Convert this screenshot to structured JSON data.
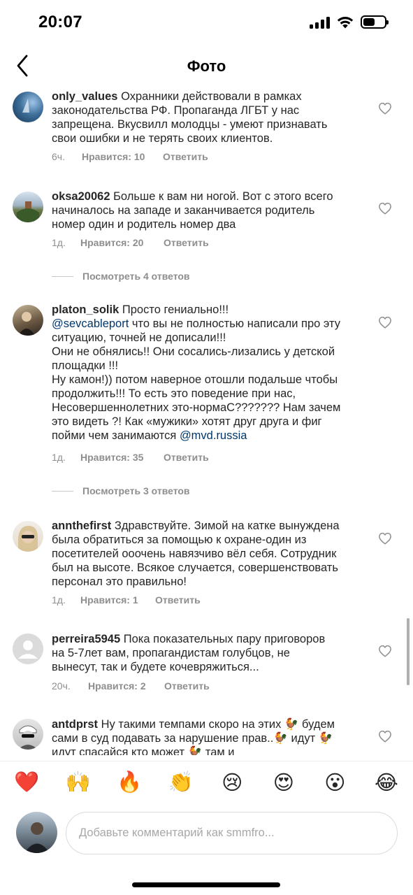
{
  "status_bar": {
    "time": "20:07",
    "battery_level": 0.55,
    "icons": [
      "signal-icon",
      "wifi-icon",
      "battery-icon"
    ]
  },
  "header": {
    "title": "Фото",
    "back_icon": "chevron-left-icon"
  },
  "comments": [
    {
      "username": "only_values",
      "lines": [
        "Охранники действовали в рамках",
        "законодательства РФ. Пропаганда ЛГБТ у нас",
        "запрещена. Вкусвилл молодцы - умеют признавать",
        "свои ошибки и не терять своих клиентов."
      ],
      "time": "6ч.",
      "likes": "Нравится: 10",
      "reply": "Ответить"
    },
    {
      "username": "oksa20062",
      "lines": [
        "Больше к вам ни ногой. Вот с этого всего",
        "начиналось на западе и заканчивается родитель",
        "номер один и родитель номер два"
      ],
      "time": "1д.",
      "likes": "Нравится: 20",
      "reply": "Ответить",
      "view_replies": "Посмотреть 4 ответов"
    },
    {
      "username": "platon_solik",
      "line1": "Просто гениально!!!",
      "mention1": "@sevcableport",
      "line2": "что вы не полностью написали про эту",
      "lines": [
        "ситуацию, точней не дописали!!!",
        "Они не обнялись!! Они сосались-лизались у детской",
        "площадки !!!",
        "Ну камон!)) потом наверное отошли  подальше чтобы",
        "продолжить!!! То есть это поведение при нас,",
        "Несовершеннолетних это-нормаС??????? Нам зачем",
        "это видеть ?! Как «мужики» хотят друг друга и фиг"
      ],
      "last_line": "пойми чем занимаются",
      "mention2": "@mvd.russia",
      "time": "1д.",
      "likes": "Нравится: 35",
      "reply": "Ответить",
      "view_replies": "Посмотреть 3 ответов"
    },
    {
      "username": "annthefirst",
      "lines": [
        "Здравствуйте. Зимой на катке вынуждена",
        "была обратиться за помощью к охране-один из",
        "посетителей ооочень навязчиво вёл себя. Сотрудник",
        "был на высоте. Всякое случается, совершенствовать",
        "персонал это правильно!"
      ],
      "time": "1д.",
      "likes": "Нравится: 1",
      "reply": "Ответить"
    },
    {
      "username": "perreira5945",
      "lines": [
        "Пока показательных пару приговоров",
        "на 5-7лет вам, пропагандистам голубцов, не",
        "вынесут, так и будете кочевряжиться..."
      ],
      "time": "20ч.",
      "likes": "Нравится: 2",
      "reply": "Ответить"
    },
    {
      "username": "antdprst",
      "lines": [
        "Ну такими темпами скоро на этих 🐓 будем",
        "сами в суд подавать за нарушение прав..🐓 идут 🐓",
        "идут спасайся кто может 🐓 там и"
      ]
    }
  ],
  "reactions": [
    "❤️",
    "🙌",
    "🔥",
    "👏",
    "😢",
    "😍",
    "😮",
    "😂"
  ],
  "compose": {
    "placeholder": "Добавьте комментарий как smmfro..."
  }
}
